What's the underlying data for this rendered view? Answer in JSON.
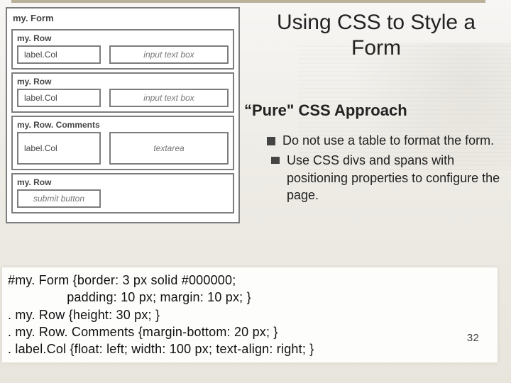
{
  "title": "Using CSS to Style a Form",
  "subtitle": "“Pure\" CSS Approach",
  "bullets": [
    " Do not use a table to format the form.",
    "Use CSS divs and spans with positioning properties to configure the page."
  ],
  "diagram": {
    "form_label": "my. Form",
    "rows": [
      {
        "row_label": "my. Row",
        "label": "label.Col",
        "input": "input text box",
        "type": "input"
      },
      {
        "row_label": "my. Row",
        "label": "label.Col",
        "input": "input text box",
        "type": "input"
      },
      {
        "row_label": "my. Row. Comments",
        "label": "label.Col",
        "input": "textarea",
        "type": "textarea"
      },
      {
        "row_label": "my. Row",
        "label": "",
        "input": "submit button",
        "type": "submit"
      }
    ]
  },
  "code": [
    "#my. Form {border: 3 px solid #000000;",
    "                padding: 10 px; margin: 10 px; }",
    ". my. Row {height: 30 px; }",
    ". my. Row. Comments {margin-bottom: 20 px; }",
    ". label.Col {float: left; width: 100 px; text-align: right; }"
  ],
  "page_number": "32"
}
